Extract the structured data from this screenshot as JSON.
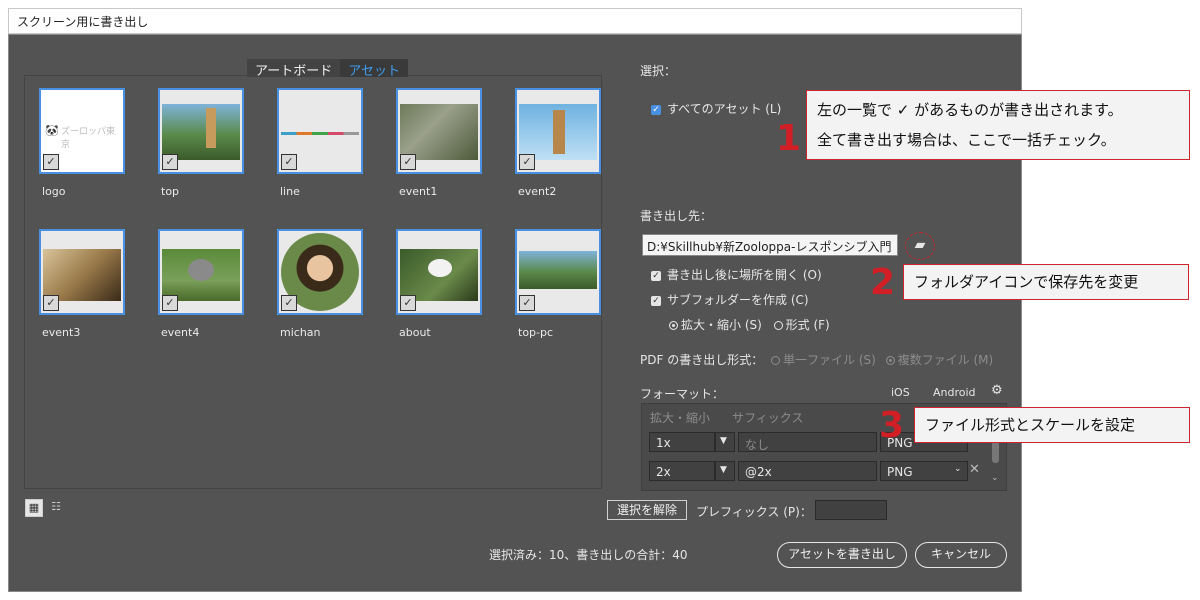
{
  "window": {
    "title": "スクリーン用に書き出し"
  },
  "tabs": [
    {
      "label": "アートボード",
      "active": false
    },
    {
      "label": "アセット",
      "active": true
    }
  ],
  "assets": [
    {
      "name": "logo",
      "checked": true
    },
    {
      "name": "top",
      "checked": true
    },
    {
      "name": "line",
      "checked": true
    },
    {
      "name": "event1",
      "checked": true
    },
    {
      "name": "event2",
      "checked": true
    },
    {
      "name": "event3",
      "checked": true
    },
    {
      "name": "event4",
      "checked": true
    },
    {
      "name": "michan",
      "checked": true
    },
    {
      "name": "about",
      "checked": true
    },
    {
      "name": "top-pc",
      "checked": true
    }
  ],
  "logo_text": "ズーロッパ東京",
  "selection": {
    "label": "選択：",
    "all_assets": "すべてのアセット (L)"
  },
  "export_to": {
    "label": "書き出し先：",
    "path": "D:¥Skillhub¥新Zooloppa-レスポンシブ入門",
    "open_after": "書き出し後に場所を開く (O)",
    "create_subfolder": "サブフォルダーを作成 (C)",
    "opt_scale": "拡大・縮小 (S)",
    "opt_format": "形式 (F)"
  },
  "pdf": {
    "label": "PDF の書き出し形式：",
    "single": "単一ファイル (S)",
    "multi": "複数ファイル (M)"
  },
  "format": {
    "label": "フォーマット：",
    "ios": "iOS",
    "android": "Android",
    "col_scale": "拡大・縮小",
    "col_suffix": "サフィックス",
    "rows": [
      {
        "scale": "1x",
        "suffix_placeholder": "なし",
        "suffix": "",
        "type": "PNG"
      },
      {
        "scale": "2x",
        "suffix": "@2x",
        "type": "PNG"
      }
    ]
  },
  "bottom": {
    "deselect": "選択を解除",
    "prefix_label": "プレフィックス (P)：",
    "status": "選択済み：10、書き出しの合計：40",
    "export_button": "アセットを書き出し",
    "cancel_button": "キャンセル"
  },
  "callouts": [
    {
      "num": "1",
      "lines": [
        "左の一覧で ✓ があるものが書き出されます。",
        "全て書き出す場合は、ここで一括チェック。"
      ]
    },
    {
      "num": "2",
      "text": "フォルダアイコンで保存先を変更"
    },
    {
      "num": "3",
      "text": "ファイル形式とスケールを設定"
    }
  ],
  "colors": {
    "dialog_bg": "#535353",
    "accent": "#4a90e2",
    "callout_red": "#d21f26"
  }
}
